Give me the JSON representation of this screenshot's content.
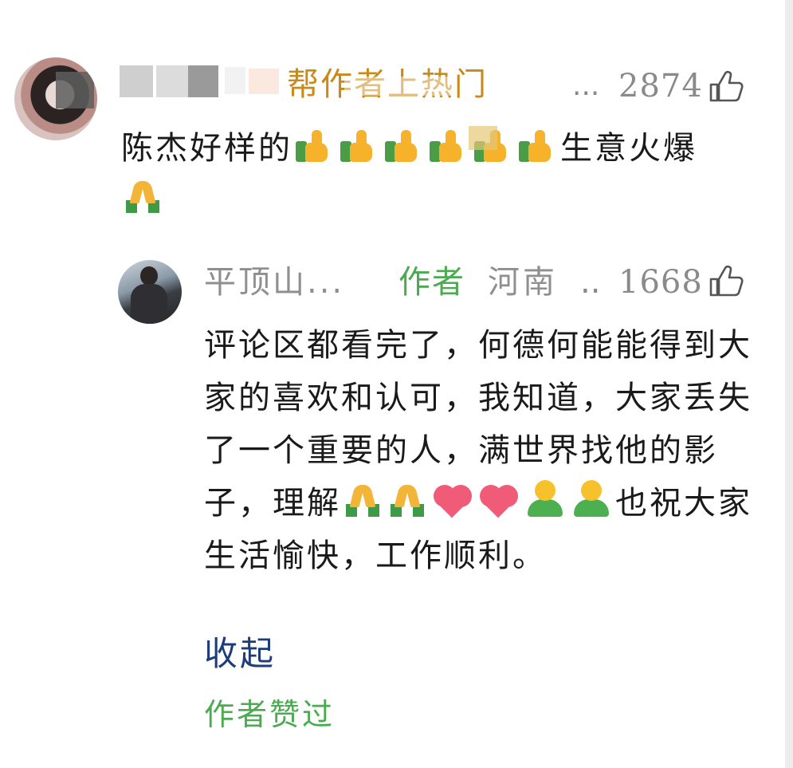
{
  "comment": {
    "header_tagline": "帮作者上热门",
    "ellipsis": "...",
    "like_count": "2874",
    "text": "陈杰好样的",
    "text_tail": "生意火爆",
    "emoji_sequence": [
      "thumbs-up",
      "thumbs-up",
      "thumbs-up",
      "thumbs-up",
      "thumbs-up",
      "thumbs-up",
      "生意火爆",
      "folded-hands"
    ]
  },
  "reply": {
    "nickname": "平顶山...",
    "author_tag": "作者",
    "location": "河南",
    "ellipsis": "..",
    "like_count": "1668",
    "text_part1": "评论区都看完了，何德何能能得到大家的喜欢和认可，我知道，大家丢失了一个重要的人，满世界找他的影子，理解",
    "text_part2": "也祝大家生活愉快，工作顺利。",
    "inline_emojis_1": [
      "folded-hands",
      "folded-hands",
      "red-heart",
      "red-heart",
      "person",
      "person"
    ]
  },
  "collapse_label": "收起",
  "author_liked_label": "作者赞过",
  "colors": {
    "green": "#4caa51",
    "link": "#1d3d7a",
    "muted": "#8a8a8a",
    "text": "#1a1a1a"
  }
}
